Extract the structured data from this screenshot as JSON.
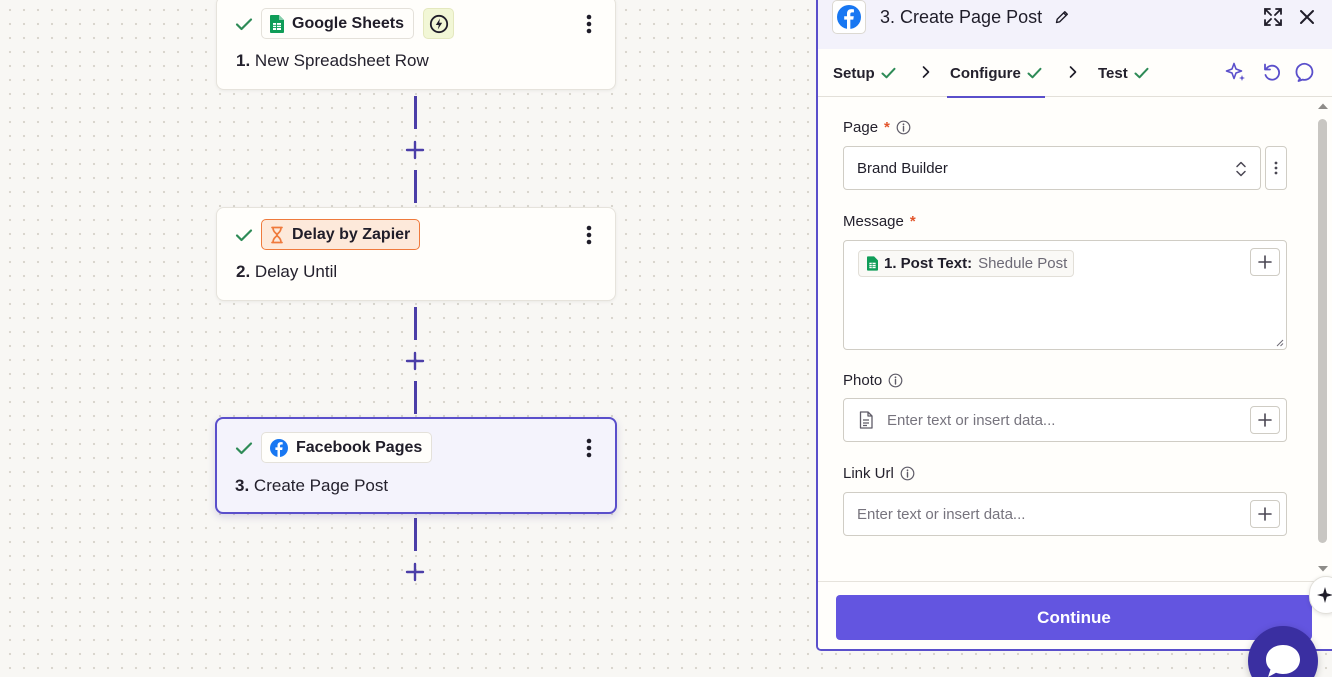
{
  "canvas": {
    "steps": [
      {
        "app": "Google Sheets",
        "number": "1.",
        "title": "New Spreadsheet Row"
      },
      {
        "app": "Delay by Zapier",
        "number": "2.",
        "title": "Delay Until"
      },
      {
        "app": "Facebook Pages",
        "number": "3.",
        "title": "Create Page Post"
      }
    ]
  },
  "panel": {
    "title": "3. Create Page Post",
    "tabs": [
      {
        "label": "Setup",
        "status": "complete"
      },
      {
        "label": "Configure",
        "status": "complete",
        "active": true
      },
      {
        "label": "Test",
        "status": "complete"
      }
    ],
    "fields": {
      "page": {
        "label": "Page",
        "required": "*",
        "value": "Brand Builder"
      },
      "message": {
        "label": "Message",
        "required": "*",
        "chip_key": "1. Post Text:",
        "chip_value": "Shedule Post"
      },
      "photo": {
        "label": "Photo",
        "placeholder": "Enter text or insert data..."
      },
      "link_url": {
        "label": "Link Url",
        "placeholder": "Enter text or insert data..."
      }
    },
    "continue_label": "Continue"
  },
  "icons": {
    "check": "check-icon",
    "kebab": "kebab-menu-icon",
    "sheets": "google-sheets-icon",
    "delay": "hourglass-icon",
    "facebook": "facebook-icon",
    "trigger": "lightning-icon"
  },
  "colors": {
    "accent": "#5a4fcb",
    "button": "#6355e0",
    "check": "#2e8b57",
    "facebook": "#1877f2",
    "sheets": "#0f9d58",
    "delay": "#ef7a3c",
    "required": "#e2552b"
  }
}
